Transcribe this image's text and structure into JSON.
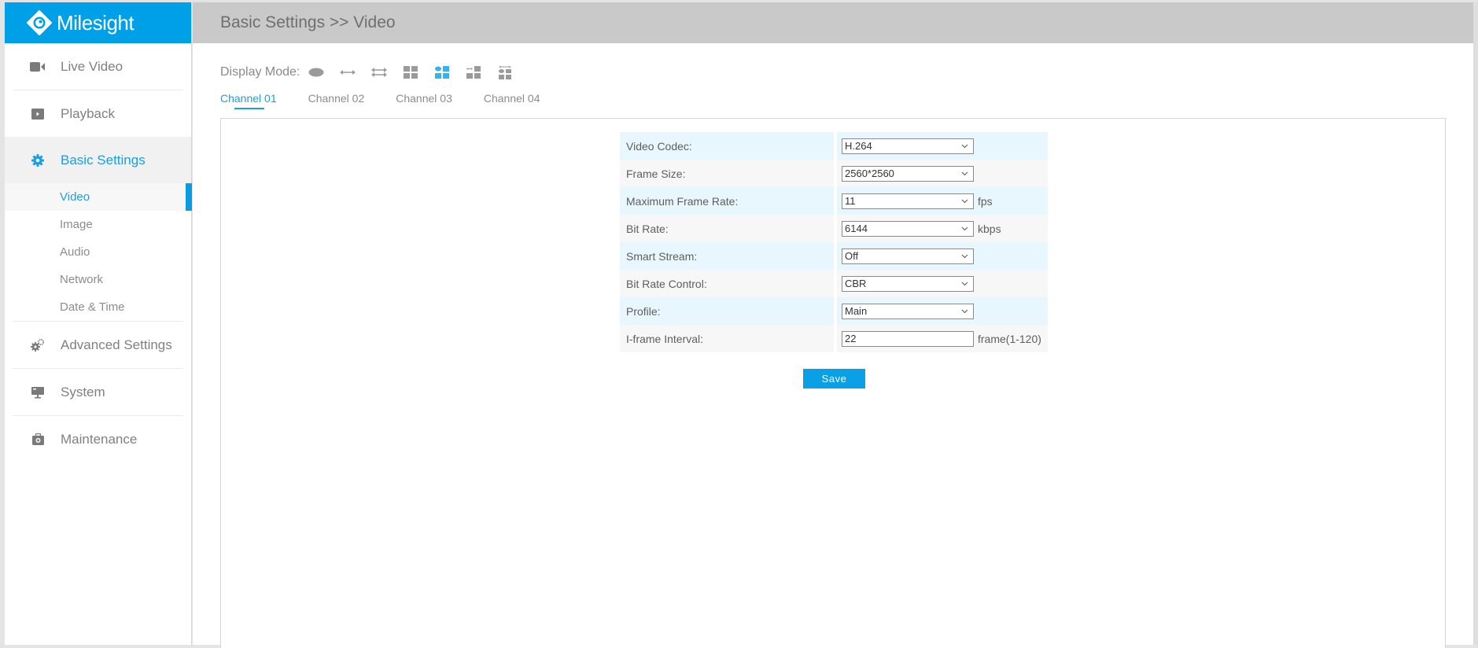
{
  "app": {
    "brand": "Milesight",
    "brand_color": "#00a0e9",
    "accent_color": "#1a9fe0"
  },
  "sidebar": {
    "items": [
      {
        "label": "Live Video",
        "icon": "video-camera-icon"
      },
      {
        "label": "Playback",
        "icon": "play-icon"
      },
      {
        "label": "Basic Settings",
        "icon": "gear-icon",
        "active": true,
        "children": [
          {
            "label": "Video",
            "active": true
          },
          {
            "label": "Image"
          },
          {
            "label": "Audio"
          },
          {
            "label": "Network"
          },
          {
            "label": "Date & Time"
          }
        ]
      },
      {
        "label": "Advanced Settings",
        "icon": "gears-icon"
      },
      {
        "label": "System",
        "icon": "monitor-icon"
      },
      {
        "label": "Maintenance",
        "icon": "toolbox-icon"
      }
    ]
  },
  "header": {
    "breadcrumb": "Basic Settings >> Video"
  },
  "display_mode": {
    "label": "Display Mode:",
    "modes": [
      "fisheye",
      "panorama",
      "double-panorama",
      "quad",
      "fisheye-plus-3",
      "panorama-plus-3",
      "panorama-fisheye-plus-2"
    ],
    "selected_index": 4
  },
  "channels": {
    "tabs": [
      "Channel 01",
      "Channel 02",
      "Channel 03",
      "Channel 04"
    ],
    "active_index": 0
  },
  "form": {
    "rows": [
      {
        "label": "Video Codec:",
        "type": "select",
        "value": "H.264",
        "unit": ""
      },
      {
        "label": "Frame Size:",
        "type": "select",
        "value": "2560*2560",
        "unit": ""
      },
      {
        "label": "Maximum Frame Rate:",
        "type": "select",
        "value": "11",
        "unit": "fps"
      },
      {
        "label": "Bit Rate:",
        "type": "select",
        "value": "6144",
        "unit": "kbps"
      },
      {
        "label": "Smart Stream:",
        "type": "select",
        "value": "Off",
        "unit": ""
      },
      {
        "label": "Bit Rate Control:",
        "type": "select",
        "value": "CBR",
        "unit": ""
      },
      {
        "label": "Profile:",
        "type": "select",
        "value": "Main",
        "unit": ""
      },
      {
        "label": "I-frame Interval:",
        "type": "text",
        "value": "22",
        "unit": "frame(1-120)"
      }
    ],
    "save_label": "Save"
  }
}
